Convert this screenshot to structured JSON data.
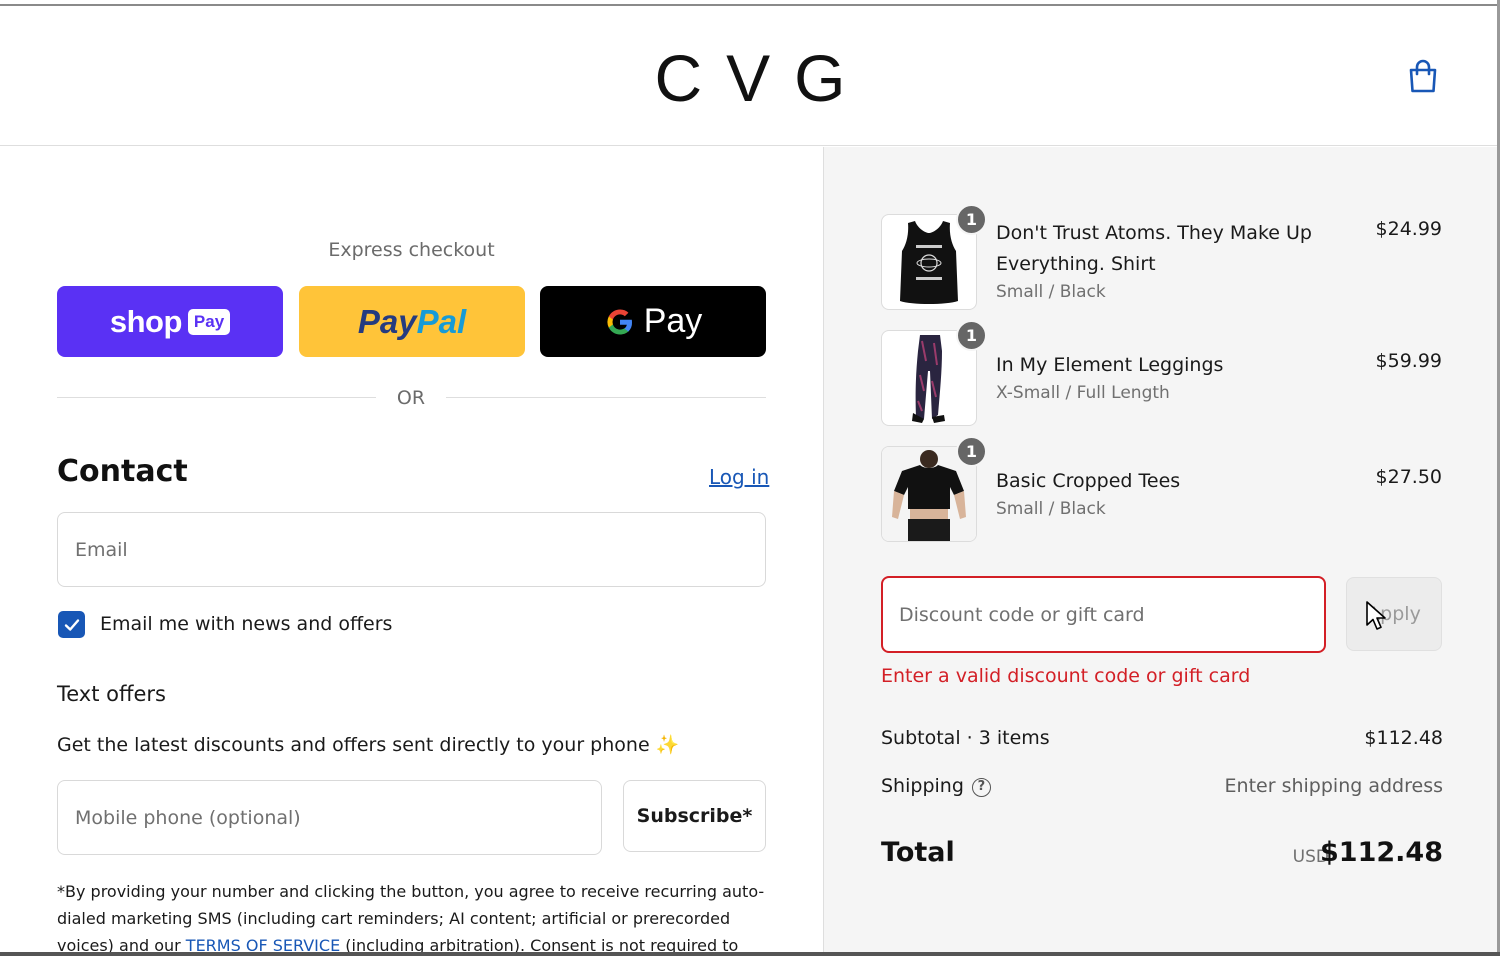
{
  "header": {
    "logo": "CVG",
    "cart_icon": "shopping-bag-icon"
  },
  "express": {
    "title": "Express checkout",
    "shop_pay": {
      "word": "shop",
      "badge": "Pay"
    },
    "paypal": {
      "part1": "Pay",
      "part2": "Pal"
    },
    "gpay": {
      "g": "G",
      "word": "Pay"
    },
    "or": "OR"
  },
  "contact": {
    "heading": "Contact",
    "login": "Log in",
    "email_placeholder": "Email",
    "news_checkbox_label": "Email me with news and offers",
    "news_checked": true
  },
  "text_offers": {
    "heading": "Text offers",
    "description": "Get the latest discounts and offers sent directly to your phone ✨",
    "phone_placeholder": "Mobile phone (optional)",
    "subscribe": "Subscribe*",
    "legal_part1": "*By providing your number and clicking the button, you agree to receive recurring auto-dialed marketing SMS (including cart reminders; AI content; artificial or prerecorded voices) and our ",
    "legal_link": "TERMS OF SERVICE",
    "legal_part2": " (including arbitration). Consent is not required to"
  },
  "order": {
    "items": [
      {
        "qty": "1",
        "name": "Don't Trust Atoms. They Make Up Everything. Shirt",
        "variant": "Small / Black",
        "price": "$24.99"
      },
      {
        "qty": "1",
        "name": "In My Element Leggings",
        "variant": "X-Small / Full Length",
        "price": "$59.99"
      },
      {
        "qty": "1",
        "name": "Basic Cropped Tees",
        "variant": "Small / Black",
        "price": "$27.50"
      }
    ],
    "discount_placeholder": "Discount code or gift card",
    "apply": "Apply",
    "error": "Enter a valid discount code or gift card",
    "subtotal_label": "Subtotal · 3 items",
    "subtotal_value": "$112.48",
    "shipping_label": "Shipping",
    "shipping_value": "Enter shipping address",
    "total_label": "Total",
    "currency": "USD",
    "total_value": "$112.48"
  },
  "colors": {
    "accent_blue": "#1857b6",
    "shop_pay_purple": "#5a31f4",
    "paypal_yellow": "#ffc439",
    "error_red": "#d31f26"
  }
}
